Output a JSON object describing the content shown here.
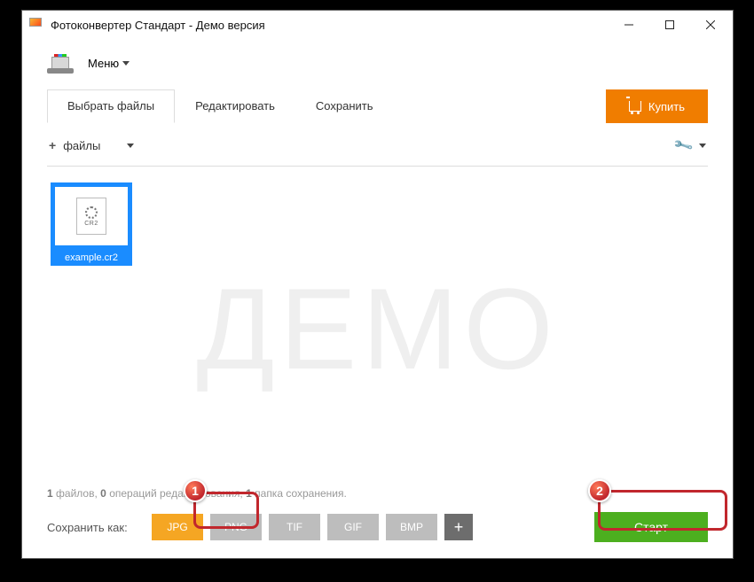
{
  "window": {
    "title": "Фотоконвертер Стандарт - Демо версия"
  },
  "menu": {
    "label": "Меню"
  },
  "tabs": {
    "select": "Выбрать файлы",
    "edit": "Редактировать",
    "save": "Сохранить",
    "buy": "Купить"
  },
  "toolbar": {
    "files": "файлы"
  },
  "watermark": "ДЕМО",
  "thumb": {
    "ext": "CR2",
    "filename": "example.cr2"
  },
  "status": {
    "files_n": "1",
    "files_w": "файлов,",
    "ops_n": "0",
    "ops_w": "операций редактирования,",
    "fold_n": "1",
    "fold_w": "папка сохранения."
  },
  "bottom": {
    "save_as": "Сохранить как:",
    "formats": {
      "jpg": "JPG",
      "png": "PNG",
      "tif": "TIF",
      "gif": "GIF",
      "bmp": "BMP",
      "plus": "+"
    },
    "start": "Старт"
  },
  "callouts": {
    "one": "1",
    "two": "2"
  }
}
